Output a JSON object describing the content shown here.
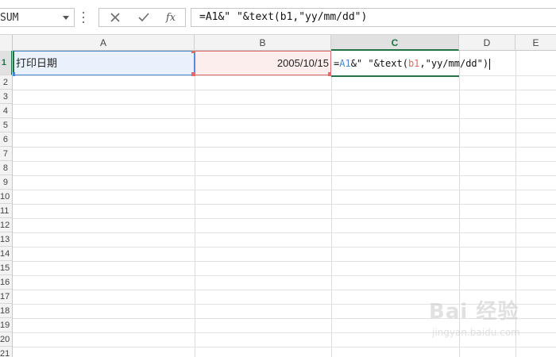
{
  "formula_bar": {
    "name_box": "SUM",
    "cancel_icon": "close-icon",
    "enter_icon": "check-icon",
    "fx_label": "fx",
    "formula": "=A1&\" \"&text(b1,\"yy/mm/dd\")"
  },
  "grid": {
    "columns": [
      "A",
      "B",
      "C",
      "D",
      "E"
    ],
    "active_column": "C",
    "rows": [
      "1",
      "2",
      "3",
      "4",
      "5",
      "6",
      "7",
      "8",
      "9",
      "10",
      "11",
      "12",
      "13",
      "14",
      "15",
      "16",
      "17",
      "18",
      "19",
      "20",
      "21"
    ],
    "active_row": "1",
    "cells": {
      "A1": "打印日期",
      "B1": "2005/10/15",
      "C1_parts": [
        "=",
        "A1",
        "&\" \"&text(",
        "b1",
        ",\"yy/mm/dd\")"
      ]
    }
  },
  "colors": {
    "accent": "#217346",
    "ref_a": "#4a86d4",
    "ref_b": "#e06a6a"
  },
  "watermark": {
    "logo": "Bai 经验",
    "sub": "jingyan.baidu.com"
  }
}
